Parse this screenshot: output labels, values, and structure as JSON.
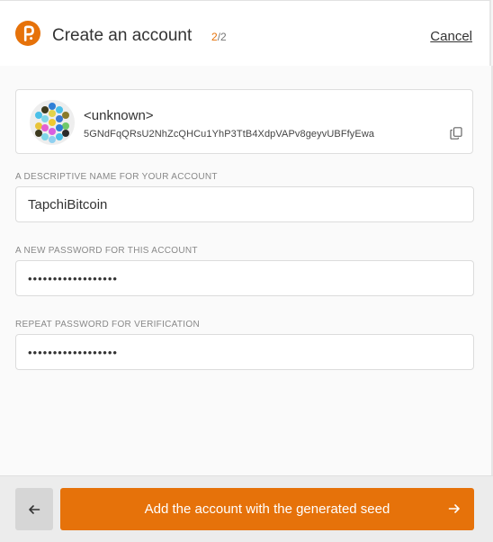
{
  "header": {
    "title": "Create an account",
    "step_current": "2",
    "step_total": "/2",
    "cancel_label": "Cancel",
    "logo_icon": "polkadot-p-logo-icon",
    "accent_color": "#e6720a"
  },
  "account": {
    "name": "<unknown>",
    "address": "5GNdFqQRsU2NhZcQHCu1YhP3TtB4XdpVAPv8geyvUBFfyEwa",
    "identicon": "polkadot-identicon",
    "copy_icon": "copy-icon"
  },
  "fields": {
    "name": {
      "label": "A DESCRIPTIVE NAME FOR YOUR ACCOUNT",
      "value": "TapchiBitcoin"
    },
    "password": {
      "label": "A NEW PASSWORD FOR THIS ACCOUNT",
      "value": "••••••••••••••••••"
    },
    "repeat_password": {
      "label": "REPEAT PASSWORD FOR VERIFICATION",
      "value": "••••••••••••••••••"
    }
  },
  "footer": {
    "back_icon": "arrow-left-icon",
    "primary_label": "Add the account with the generated seed",
    "primary_icon": "arrow-right-icon"
  }
}
